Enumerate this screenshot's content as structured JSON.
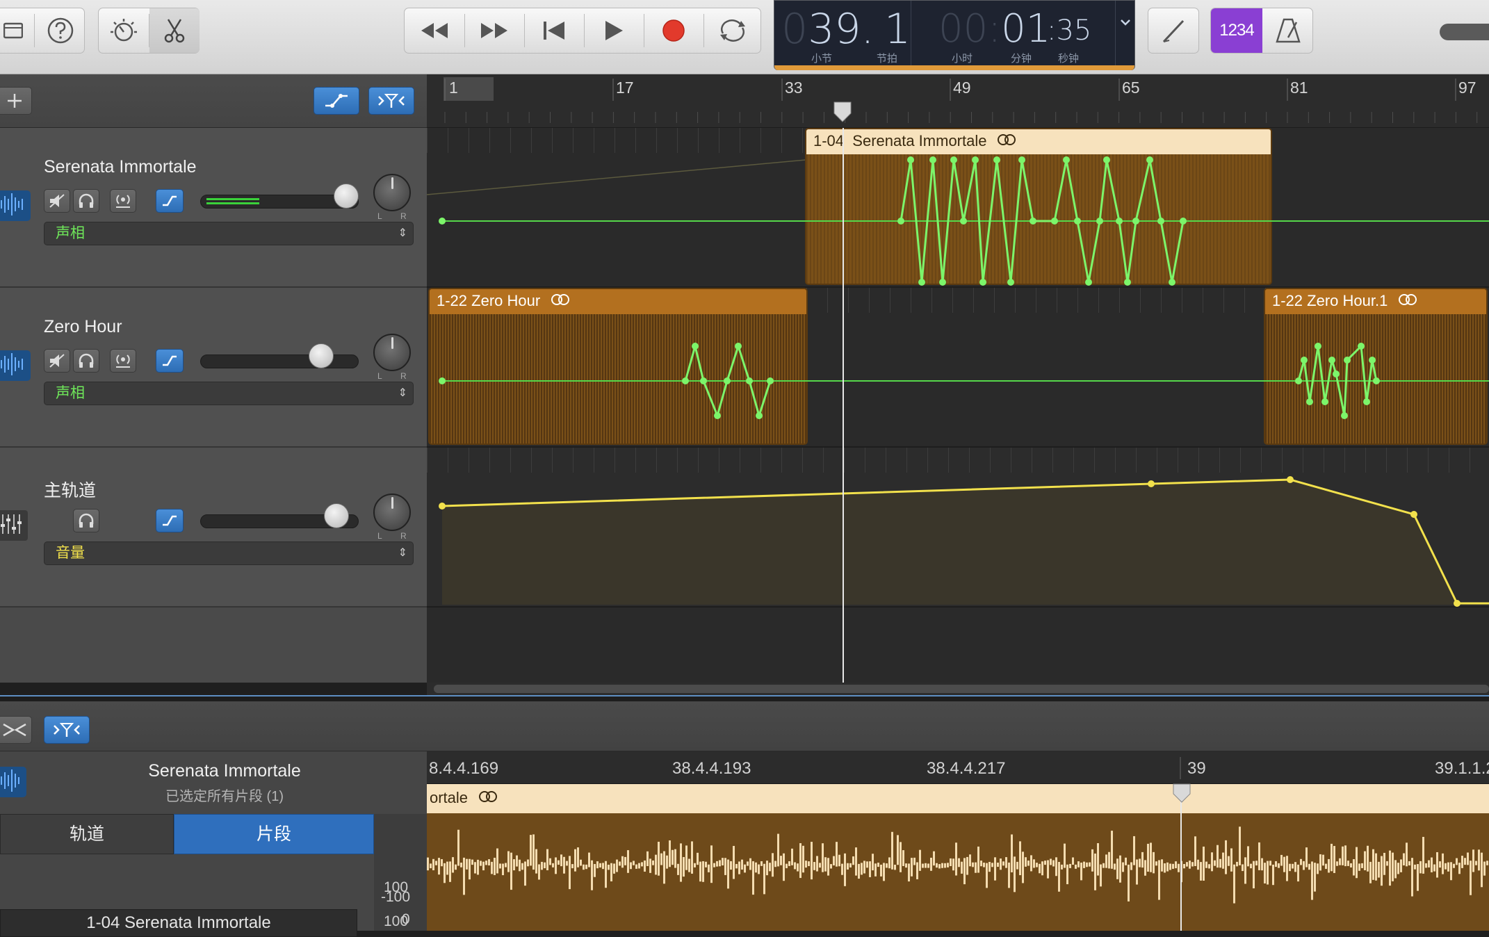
{
  "toolbar": {
    "lcd": {
      "bar_dim": "0",
      "bar": "39.",
      "beat": "1",
      "hours_dim": "00:",
      "minutes": "01",
      "seconds": ":35",
      "label_bar": "小节",
      "label_beat": "节拍",
      "label_hours": "小时",
      "label_minutes": "分钟",
      "label_seconds": "秒钟"
    },
    "count_in": "1234"
  },
  "ruler": {
    "marks": [
      "1",
      "17",
      "33",
      "49",
      "65",
      "81",
      "97"
    ]
  },
  "tracks": [
    {
      "name": "Serenata Immortale",
      "param": "声相",
      "param_color": "#6fe85a"
    },
    {
      "name": "Zero Hour",
      "param": "声相",
      "param_color": "#6fe85a"
    },
    {
      "name": "主轨道",
      "param": "音量",
      "param_color": "#f2e14c"
    }
  ],
  "regions": {
    "serenata": {
      "number": "1-04",
      "title": "Serenata Immortale"
    },
    "zero1": {
      "title": "1-22 Zero Hour"
    },
    "zero2": {
      "title": "1-22 Zero Hour.1"
    }
  },
  "editor": {
    "track_title": "Serenata Immortale",
    "selection_info": "已选定所有片段 (1)",
    "tab_track": "轨道",
    "tab_region": "片段",
    "region_field": "1-04 Serenata Immortale",
    "ruler": [
      "8.4.4.169",
      "38.4.4.193",
      "38.4.4.217",
      "39",
      "39.1.1.2"
    ],
    "region_title": "ortale",
    "y_labels": [
      "100",
      "0",
      "-100",
      "100"
    ]
  }
}
